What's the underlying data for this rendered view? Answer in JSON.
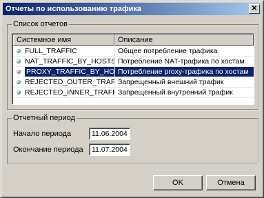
{
  "window": {
    "title": "Отчеты по использованию трафика",
    "close_glyph": "✕"
  },
  "reports": {
    "group_label": "Список отчетов",
    "columns": [
      "Системное имя",
      "Описание"
    ],
    "rows": [
      {
        "name": "FULL_TRAFFIC",
        "description": "Общее потребление трафика",
        "selected": false
      },
      {
        "name": "NAT_TRAFFIC_BY_HOSTS",
        "description": "Потребление NAT-трафика по хостам",
        "selected": false
      },
      {
        "name": "PROXY_TRAFFIC_BY_HOSTS",
        "description": "Потребление proxy-трафика по хостам",
        "selected": true
      },
      {
        "name": "REJECTED_OUTER_TRAFFIC",
        "description": "Запрещенный внешний трафик",
        "selected": false
      },
      {
        "name": "REJECTED_INNER_TRAFFIC",
        "description": "Запрещенный внутренний трафик",
        "selected": false
      }
    ]
  },
  "period": {
    "group_label": "Отчетный период",
    "start_label": "Начало периода",
    "start_value": "11.06.2004",
    "end_label": "Окончание периода",
    "end_value": "11.07.2004"
  },
  "buttons": {
    "ok": "OK",
    "cancel": "Отмена"
  }
}
